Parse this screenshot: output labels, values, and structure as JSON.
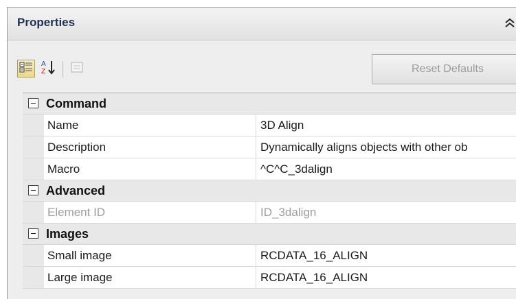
{
  "panel": {
    "title": "Properties",
    "collapse_icon": "double-chevron-up-icon"
  },
  "toolbar": {
    "categorized_icon": "categorized-view-icon",
    "alphabetical_icon": "sort-az-icon",
    "pages_icon": "property-pages-icon",
    "reset_label": "Reset Defaults"
  },
  "grid": {
    "categories": [
      {
        "label": "Command",
        "properties": [
          {
            "name": "Name",
            "value": "3D Align"
          },
          {
            "name": "Description",
            "value": "Dynamically aligns objects with other ob"
          },
          {
            "name": "Macro",
            "value": "^C^C_3dalign"
          }
        ]
      },
      {
        "label": "Advanced",
        "properties": [
          {
            "name": "Element ID",
            "value": "ID_3dalign",
            "disabled": true
          }
        ]
      },
      {
        "label": "Images",
        "properties": [
          {
            "name": "Small image",
            "value": "RCDATA_16_ALIGN"
          },
          {
            "name": "Large image",
            "value": "RCDATA_16_ALIGN"
          }
        ]
      }
    ]
  }
}
